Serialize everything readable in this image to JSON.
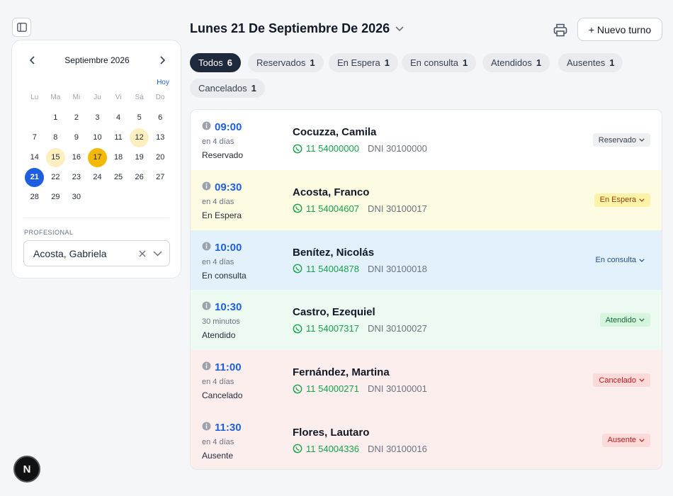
{
  "calendar": {
    "month_label": "Septiembre 2026",
    "today_label": "Hoy",
    "weekdays": [
      "Lu",
      "Ma",
      "Mi",
      "Ju",
      "Vi",
      "Sá",
      "Do"
    ],
    "days": [
      "1",
      "2",
      "3",
      "4",
      "5",
      "6",
      "7",
      "8",
      "9",
      "10",
      "11",
      "12",
      "13",
      "14",
      "15",
      "16",
      "17",
      "18",
      "19",
      "20",
      "21",
      "22",
      "23",
      "24",
      "25",
      "26",
      "27",
      "28",
      "29",
      "30"
    ],
    "selected_day": "21",
    "highlighted_days": [
      "12",
      "15"
    ],
    "strong_highlight_days": [
      "17"
    ],
    "professional_label": "PROFESIONAL",
    "professional_value": "Acosta, Gabriela"
  },
  "header": {
    "title": "Lunes 21 De Septiembre De 2026",
    "new_button": "+ Nuevo turno"
  },
  "filters": [
    {
      "label": "Todos",
      "count": "6",
      "active": true
    },
    {
      "label": "Reservados",
      "count": "1"
    },
    {
      "label": "En Espera",
      "count": "1"
    },
    {
      "label": "En consulta",
      "count": "1"
    },
    {
      "label": "Atendidos",
      "count": "1"
    },
    {
      "label": "Ausentes",
      "count": "1"
    },
    {
      "label": "Cancelados",
      "count": "1"
    }
  ],
  "appointments": [
    {
      "time": "09:00",
      "relative": "en 4 días",
      "status": "Reservado",
      "name": "Cocuzza, Camila",
      "phone": "11 54000000",
      "dni": "DNI 30100000",
      "badge": "Reservado",
      "row_bg": "#ffffff",
      "badge_bg": "#eef0f2",
      "badge_color": "#374151"
    },
    {
      "time": "09:30",
      "relative": "en 4 días",
      "status": "En Espera",
      "name": "Acosta, Franco",
      "phone": "11 54004607",
      "dni": "DNI 30100017",
      "badge": "En Espera",
      "row_bg": "#fefbe3",
      "badge_bg": "#fdf3a8",
      "badge_color": "#92400e"
    },
    {
      "time": "10:00",
      "relative": "en 4 días",
      "status": "En consulta",
      "name": "Benítez, Nicolás",
      "phone": "11 54004878",
      "dni": "DNI 30100018",
      "badge": "En consulta",
      "row_bg": "#e3f1fc",
      "badge_bg": "transparent",
      "badge_color": "#1e4e8c"
    },
    {
      "time": "10:30",
      "relative": "30 minutos",
      "status": "Atendido",
      "name": "Castro, Ezequiel",
      "phone": "11 54007317",
      "dni": "DNI 30100027",
      "badge": "Atendido",
      "row_bg": "#ecfaf1",
      "badge_bg": "#d6f5df",
      "badge_color": "#166534"
    },
    {
      "time": "11:00",
      "relative": "en 4 días",
      "status": "Cancelado",
      "name": "Fernández, Martina",
      "phone": "11 54000271",
      "dni": "DNI 30100001",
      "badge": "Cancelado",
      "row_bg": "#fdeeee",
      "badge_bg": "#fcdada",
      "badge_color": "#b91c1c"
    },
    {
      "time": "11:30",
      "relative": "en 4 días",
      "status": "Ausente",
      "name": "Flores, Lautaro",
      "phone": "11 54004336",
      "dni": "DNI 30100016",
      "badge": "Ausente",
      "row_bg": "#fdeeee",
      "badge_bg": "#fcdada",
      "badge_color": "#b91c1c"
    }
  ],
  "floating": {
    "label": "N"
  }
}
